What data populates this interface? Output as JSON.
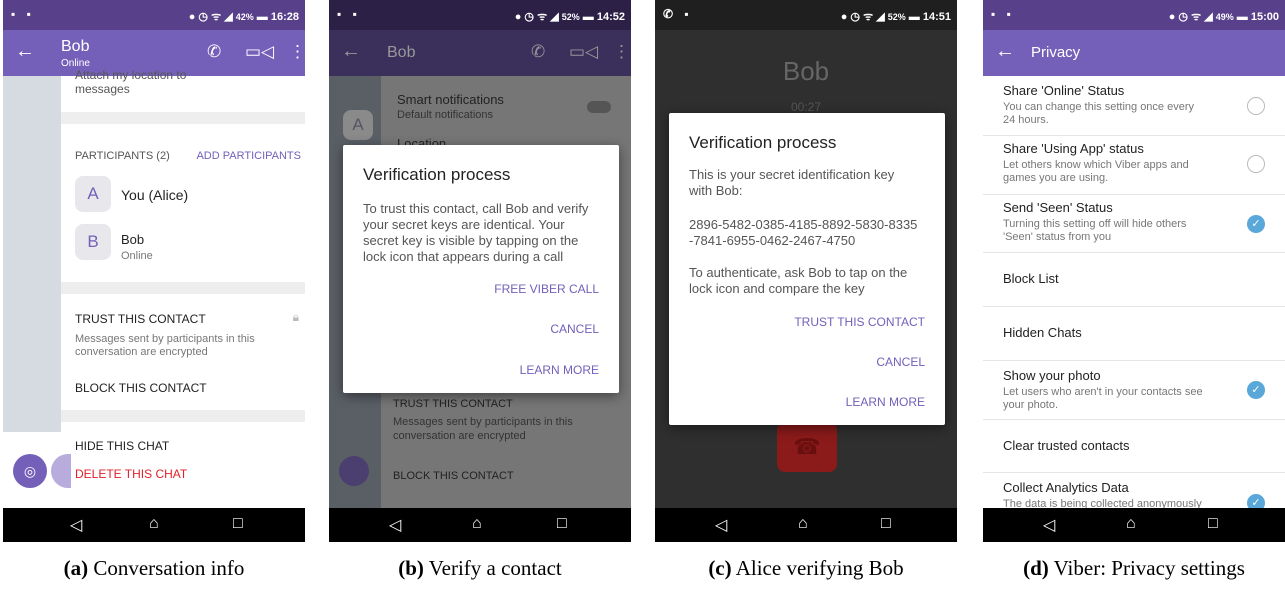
{
  "status_bars": [
    {
      "right": "42%",
      "time": "16:28"
    },
    {
      "right": "52%",
      "time": "14:52"
    },
    {
      "right": "52%",
      "time": "14:51"
    },
    {
      "right": "49%",
      "time": "15:00"
    }
  ],
  "panel_a": {
    "title": "Bob",
    "subtitle": "Online",
    "partial_text_1": "Attach my location to",
    "partial_text_2": "messages",
    "participants_header": "PARTICIPANTS (2)",
    "add_participants": "ADD PARTICIPANTS",
    "participants": [
      {
        "initial": "A",
        "name": "You (Alice)",
        "status": ""
      },
      {
        "initial": "B",
        "name": "Bob",
        "status": "Online"
      }
    ],
    "trust_header": "TRUST THIS CONTACT",
    "trust_desc_1": "Messages sent by participants in this",
    "trust_desc_2": "conversation are encrypted",
    "block": "BLOCK THIS CONTACT",
    "hide": "HIDE THIS CHAT",
    "delete": "DELETE THIS CHAT",
    "caption_label": "(a)",
    "caption_text": "Conversation info"
  },
  "panel_b": {
    "title": "Bob",
    "bg_smart": "Smart notifications",
    "bg_smart_sub": "Default notifications",
    "bg_location": "Location",
    "bg_avatar": "A",
    "bg_trust": "TRUST THIS CONTACT",
    "bg_trust_desc_1": "Messages sent by participants in this",
    "bg_trust_desc_2": "conversation are encrypted",
    "bg_block": "BLOCK THIS CONTACT",
    "dialog_title": "Verification process",
    "dialog_body": [
      "To trust this contact, call Bob and verify",
      "your secret keys are identical. Your",
      "secret key is visible by tapping on the",
      "lock icon that appears during a call"
    ],
    "action_1": "FREE VIBER CALL",
    "action_2": "CANCEL",
    "action_3": "LEARN MORE",
    "caption_label": "(b)",
    "caption_text": "Verify a contact"
  },
  "panel_c": {
    "caller": "Bob",
    "timer": "00:27",
    "dialog_title": "Verification process",
    "body_1": [
      "This is your secret identification key",
      "with Bob:"
    ],
    "key": [
      "2896-5482-0385-4185-8892-5830-8335",
      "-7841-6955-0462-2467-4750"
    ],
    "body_2": [
      "To authenticate, ask Bob to tap on the",
      "lock icon and compare the key"
    ],
    "action_1": "TRUST THIS CONTACT",
    "action_2": "CANCEL",
    "action_3": "LEARN MORE",
    "caption_label": "(c)",
    "caption_text": "Alice verifying Bob"
  },
  "panel_d": {
    "title": "Privacy",
    "items": [
      {
        "title": "Share 'Online' Status",
        "sub": [
          "You can change this setting once every",
          "24 hours."
        ],
        "control": "radio"
      },
      {
        "title": "Share 'Using App' status",
        "sub": [
          "Let others know which Viber apps and",
          "games you are using."
        ],
        "control": "radio"
      },
      {
        "title": "Send 'Seen' Status",
        "sub": [
          "Turning this setting off will hide others",
          "'Seen' status from you"
        ],
        "control": "check"
      },
      {
        "title": "Block List",
        "sub": [],
        "control": ""
      },
      {
        "title": "Hidden Chats",
        "sub": [],
        "control": ""
      },
      {
        "title": "Show your photo",
        "sub": [
          "Let users who aren't in your contacts see",
          "your photo."
        ],
        "control": "check"
      },
      {
        "title": "Clear trusted contacts",
        "sub": [],
        "control": ""
      },
      {
        "title": "Collect Analytics Data",
        "sub": [
          "The data is being collected anonymously"
        ],
        "control": "check"
      }
    ],
    "caption_label": "(d)",
    "caption_text": "Viber: Privacy settings"
  },
  "colors": {
    "accent": "#7460b9",
    "statusbar": "#58408a",
    "danger": "#e0202a",
    "check": "#5aa7d9"
  },
  "icons": [
    "back-arrow-icon",
    "phone-icon",
    "video-icon",
    "more-vert-icon",
    "lock-icon",
    "nav-back-icon",
    "nav-home-icon",
    "nav-recents-icon",
    "end-call-icon",
    "chat-icon"
  ]
}
